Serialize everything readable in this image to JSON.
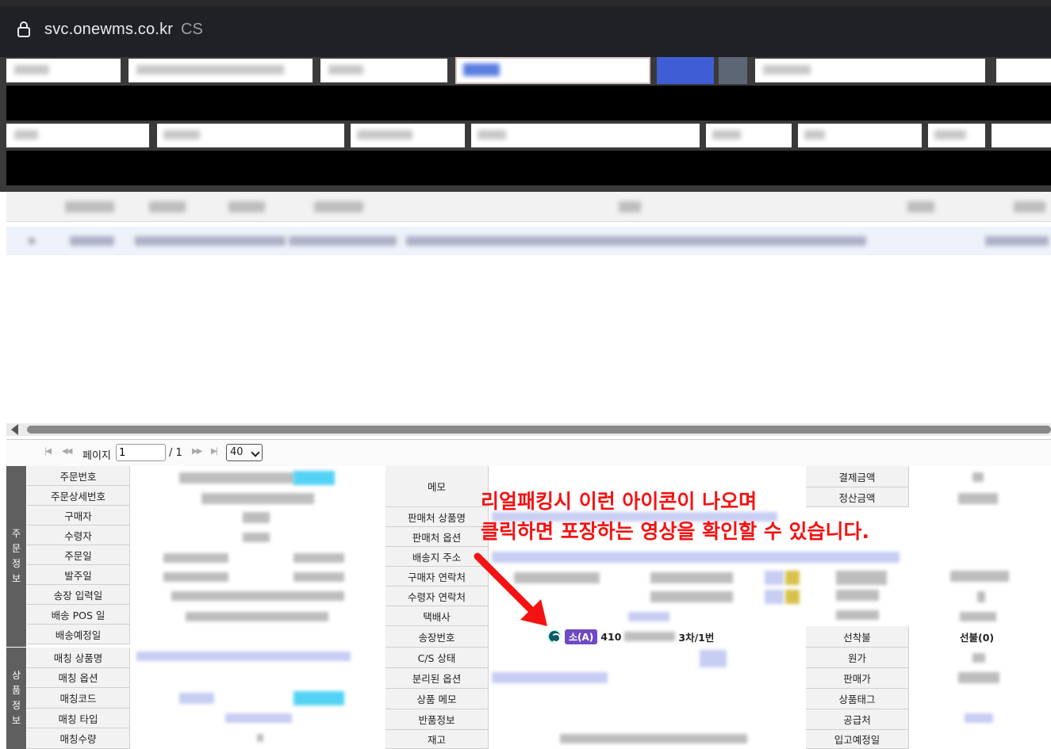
{
  "browser": {
    "url": "svc.onewms.co.kr",
    "suffix": "CS"
  },
  "pager": {
    "page_label": "페이지",
    "page_value": "1",
    "page_total": "/ 1",
    "page_size": "40"
  },
  "order_section": {
    "title": "주\n문\n정\n보",
    "labels": [
      "주문번호",
      "주문상세번호",
      "구매자",
      "수령자",
      "주문일",
      "발주일",
      "송장 입력일",
      "배송 POS 일",
      "배송예정일"
    ]
  },
  "product_section": {
    "title": "상\n품\n정\n보",
    "labels": [
      "매칭 상품명",
      "매칭 옵션",
      "매칭코드",
      "매칭 타입",
      "매칭수량"
    ]
  },
  "middle_labels": [
    "메모",
    "판매처 상품명",
    "판매처 옵션",
    "배송지 주소",
    "구매자 연락처",
    "수령자 연락처",
    "택배사",
    "송장번호",
    "C/S 상태",
    "분리된 옵션",
    "상품 메모",
    "반품정보",
    "재고"
  ],
  "right_labels": [
    "결제금액",
    "정산금액",
    "선착불",
    "원가",
    "판매가",
    "상품태그",
    "공급처",
    "입고예정일"
  ],
  "tracking": {
    "carrier": "소(A)",
    "number_prefix": "410",
    "number_suffix": "3차/1번",
    "prepaid": "선불(0)"
  },
  "annotation": {
    "line1": "리얼패킹시 이런 아이콘이 나오며",
    "line2": "클릭하면 포장하는 영상을 확인할 수 있습니다."
  }
}
